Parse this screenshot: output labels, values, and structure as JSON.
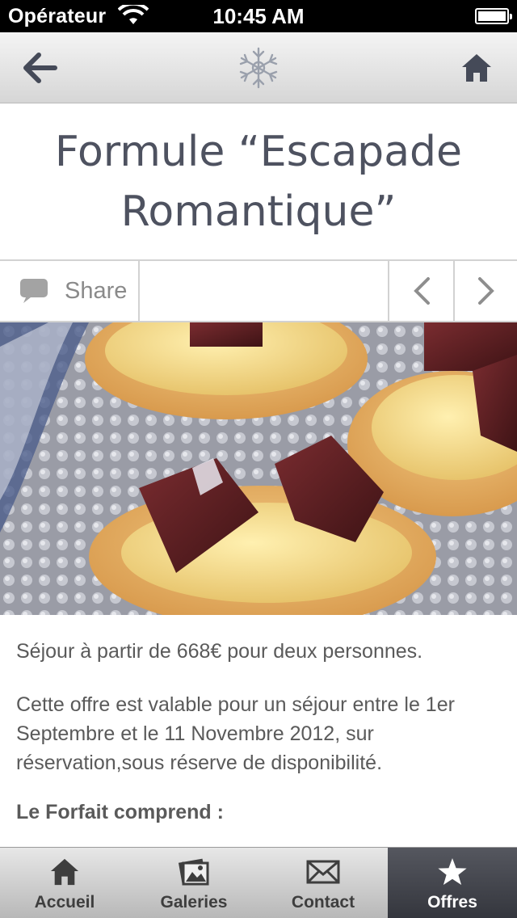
{
  "status_bar": {
    "carrier": "Opérateur",
    "time": "10:45 AM"
  },
  "nav": {
    "back_icon": "back-arrow-icon",
    "logo_icon": "snowflake-logo-icon",
    "home_icon": "home-icon"
  },
  "page": {
    "title": "Formule “Escapade Romantique”"
  },
  "toolbar": {
    "share_label": "Share",
    "share_icon": "speech-bubble-icon",
    "prev_icon": "chevron-left-icon",
    "next_icon": "chevron-right-icon"
  },
  "content": {
    "price_line": "Séjour à partir de 668€ pour deux personnes.",
    "validity": "Cette offre est valable pour un séjour entre le 1er Septembre et le 11 Novembre 2012, sur réservation,sous réserve de disponibilité.",
    "package_heading": "Le Forfait comprend :"
  },
  "tabs": [
    {
      "label": "Accueil",
      "icon": "home-icon",
      "active": false
    },
    {
      "label": "Galeries",
      "icon": "gallery-icon",
      "active": false
    },
    {
      "label": "Contact",
      "icon": "envelope-icon",
      "active": false
    },
    {
      "label": "Offres",
      "icon": "star-icon",
      "active": true
    }
  ],
  "colors": {
    "title": "#4e5260",
    "active_tab": "#3e4048",
    "nav_icons": "#454a58"
  }
}
